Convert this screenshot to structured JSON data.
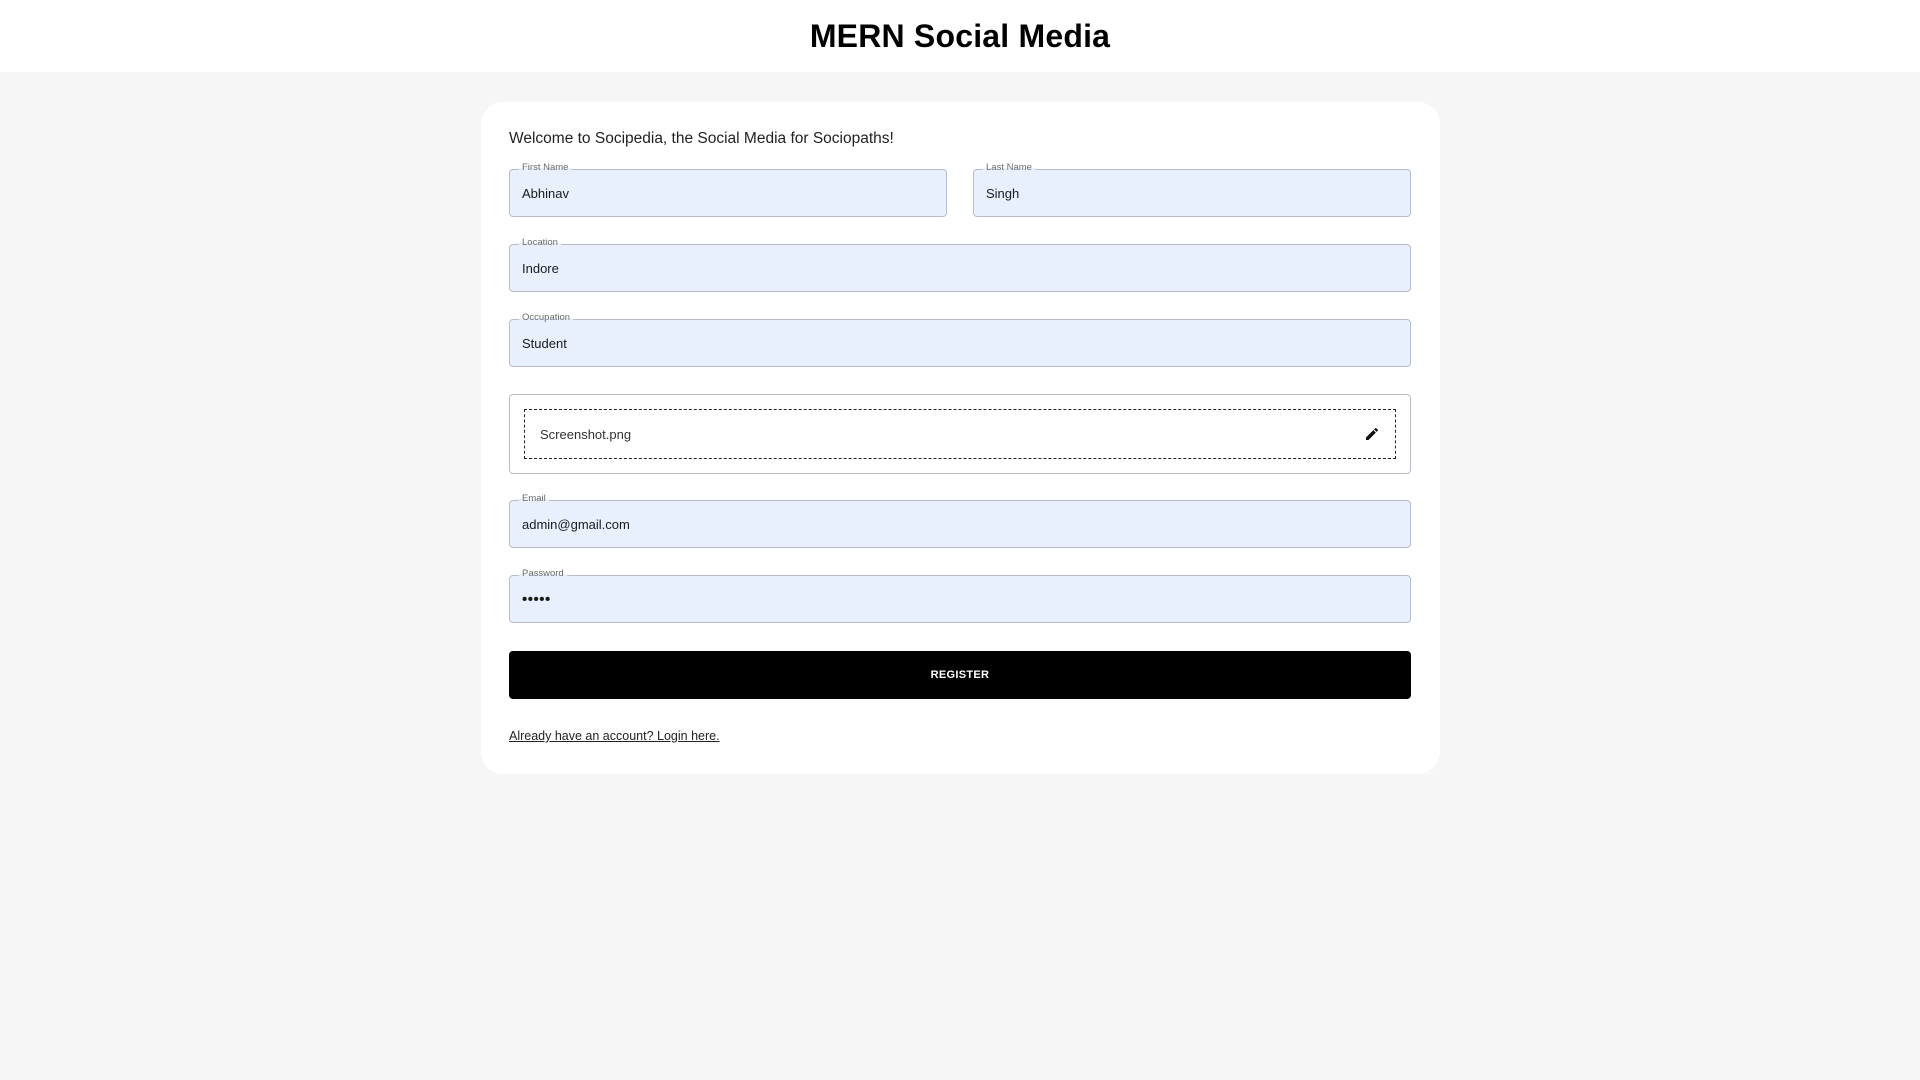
{
  "navbar": {
    "brand": "MERN Social Media"
  },
  "form": {
    "welcome": "Welcome to Socipedia, the Social Media for Sociopaths!",
    "first_name": {
      "label": "First Name",
      "value": "Abhinav"
    },
    "last_name": {
      "label": "Last Name",
      "value": "Singh"
    },
    "location": {
      "label": "Location",
      "value": "Indore"
    },
    "occupation": {
      "label": "Occupation",
      "value": "Student"
    },
    "picture": {
      "filename": "Screenshot.png",
      "icon": "edit-icon"
    },
    "email": {
      "label": "Email",
      "value": "admin@gmail.com"
    },
    "password": {
      "label": "Password",
      "value": "•••••"
    },
    "register_label": "REGISTER",
    "login_link": "Already have an account? Login here."
  },
  "colors": {
    "page_background": "#f6f6f6",
    "card_background": "#ffffff",
    "input_fill": "#e8f0fe",
    "button_background": "#000000",
    "button_text": "#ffffff"
  }
}
